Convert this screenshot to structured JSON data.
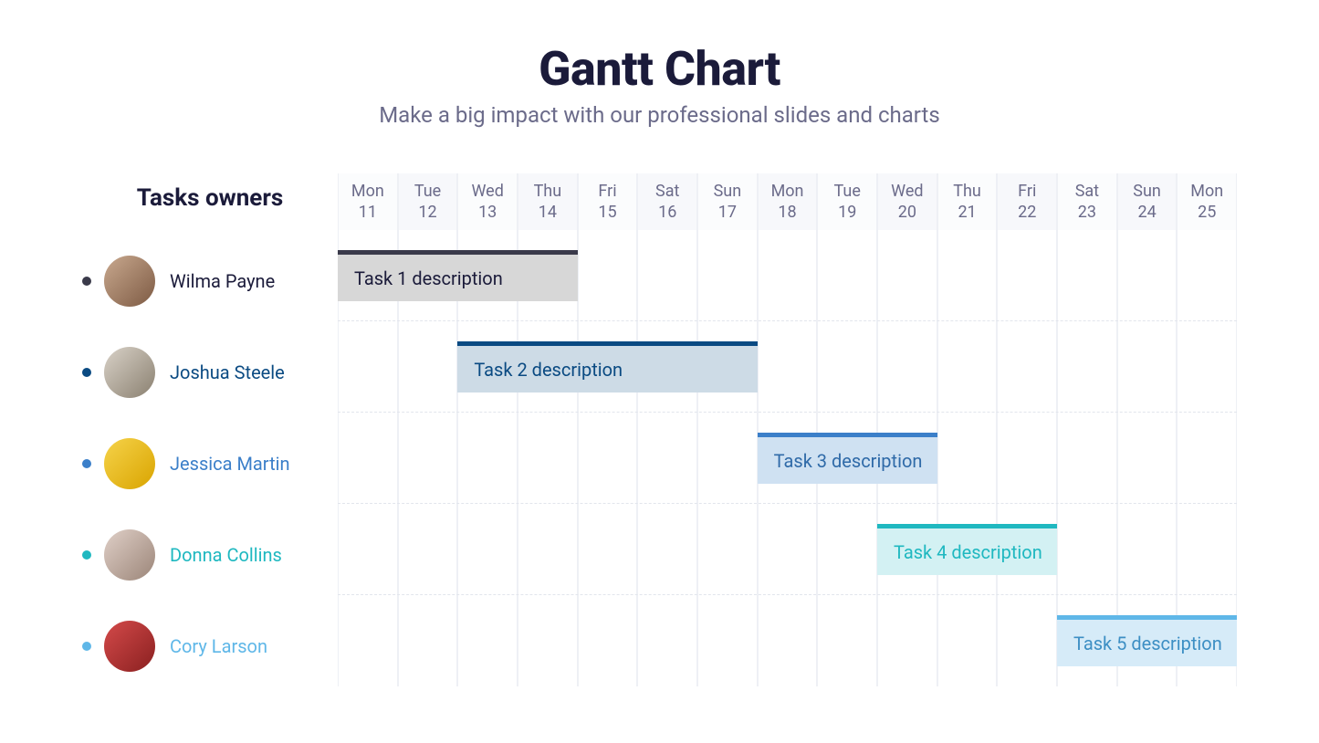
{
  "header": {
    "title": "Gantt Chart",
    "subtitle": "Make a big impact with our professional slides and charts"
  },
  "owners_title": "Tasks owners",
  "days": [
    {
      "dow": "Mon",
      "num": "11"
    },
    {
      "dow": "Tue",
      "num": "12"
    },
    {
      "dow": "Wed",
      "num": "13"
    },
    {
      "dow": "Thu",
      "num": "14"
    },
    {
      "dow": "Fri",
      "num": "15"
    },
    {
      "dow": "Sat",
      "num": "16"
    },
    {
      "dow": "Sun",
      "num": "17"
    },
    {
      "dow": "Mon",
      "num": "18"
    },
    {
      "dow": "Tue",
      "num": "19"
    },
    {
      "dow": "Wed",
      "num": "20"
    },
    {
      "dow": "Thu",
      "num": "21"
    },
    {
      "dow": "Fri",
      "num": "22"
    },
    {
      "dow": "Sat",
      "num": "23"
    },
    {
      "dow": "Sun",
      "num": "24"
    },
    {
      "dow": "Mon",
      "num": "25"
    }
  ],
  "owners": [
    {
      "name": "Wilma Payne",
      "color": "#3a3a4a",
      "name_color": "#1b1b3a",
      "avatar_bg": "linear-gradient(135deg,#c9a98f,#7d5a43)"
    },
    {
      "name": "Joshua Steele",
      "color": "#0a4a82",
      "name_color": "#0a4a82",
      "avatar_bg": "linear-gradient(135deg,#d9d2c8,#8a8070)"
    },
    {
      "name": "Jessica Martin",
      "color": "#3b7fc9",
      "name_color": "#3b7fc9",
      "avatar_bg": "linear-gradient(135deg,#f6d34a,#d9a400)"
    },
    {
      "name": "Donna Collins",
      "color": "#1fb8c0",
      "name_color": "#1fb8c0",
      "avatar_bg": "linear-gradient(135deg,#e0d0c8,#9b8578)"
    },
    {
      "name": "Cory Larson",
      "color": "#5fb7e8",
      "name_color": "#5fb7e8",
      "avatar_bg": "linear-gradient(135deg,#d44a4a,#8a2020)"
    }
  ],
  "tasks": [
    {
      "label": "Task 1 description",
      "start": 0,
      "span": 4,
      "fill": "#d7d7d7",
      "accent": "#3a3a4a",
      "text": "#1b1b3a"
    },
    {
      "label": "Task 2 description",
      "start": 2,
      "span": 5,
      "fill": "#cddbe6",
      "accent": "#0a4a82",
      "text": "#0a4a82"
    },
    {
      "label": "Task 3 description",
      "start": 7,
      "span": 3,
      "fill": "#cfe1f2",
      "accent": "#3b7fc9",
      "text": "#2f6aa8"
    },
    {
      "label": "Task 4 description",
      "start": 9,
      "span": 3,
      "fill": "#d3f1f3",
      "accent": "#1fb8c0",
      "text": "#1fb8c0"
    },
    {
      "label": "Task 5 description",
      "start": 12,
      "span": 3,
      "fill": "#d6ebf8",
      "accent": "#5fb7e8",
      "text": "#3d8fc4"
    }
  ],
  "chart_data": {
    "type": "gantt",
    "title": "Gantt Chart",
    "date_columns": [
      "Mon 11",
      "Tue 12",
      "Wed 13",
      "Thu 14",
      "Fri 15",
      "Sat 16",
      "Sun 17",
      "Mon 18",
      "Tue 19",
      "Wed 20",
      "Thu 21",
      "Fri 22",
      "Sat 23",
      "Sun 24",
      "Mon 25"
    ],
    "series": [
      {
        "owner": "Wilma Payne",
        "task": "Task 1 description",
        "start_index": 0,
        "end_index": 3
      },
      {
        "owner": "Joshua Steele",
        "task": "Task 2 description",
        "start_index": 2,
        "end_index": 6
      },
      {
        "owner": "Jessica Martin",
        "task": "Task 3 description",
        "start_index": 7,
        "end_index": 9
      },
      {
        "owner": "Donna Collins",
        "task": "Task 4 description",
        "start_index": 9,
        "end_index": 11
      },
      {
        "owner": "Cory Larson",
        "task": "Task 5 description",
        "start_index": 12,
        "end_index": 14
      }
    ]
  }
}
